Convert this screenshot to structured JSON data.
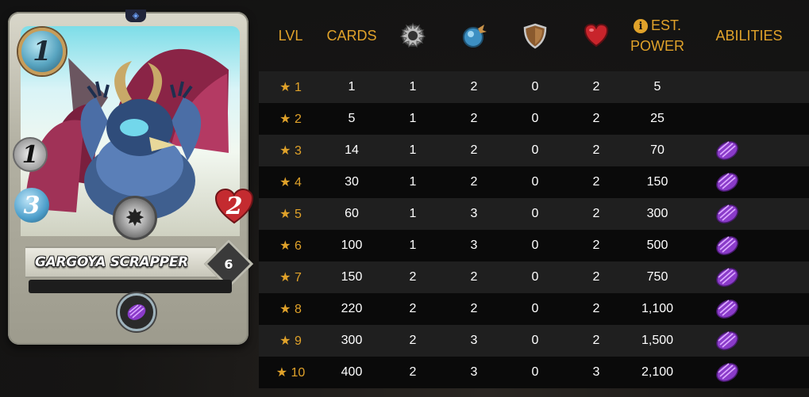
{
  "card": {
    "name": "GARGOYA SCRAPPER",
    "mana": "1",
    "melee": "1",
    "speed": "3",
    "health": "2",
    "level": "6",
    "ability_icon": "scrap-ability-icon",
    "colors": {
      "border": "#bdbcb0",
      "mana": "#58a4c0",
      "health": "#c42b30",
      "ability": "#9a3fd6"
    }
  },
  "table": {
    "headers": {
      "lvl": "LVL",
      "cards": "CARDS",
      "melee_icon": "melee-attack-icon",
      "speed_icon": "speed-icon",
      "armor_icon": "armor-shield-icon",
      "health_icon": "health-heart-icon",
      "est_power_line1": "EST.",
      "est_power_line2": "POWER",
      "abilities": "ABILITIES"
    },
    "rows": [
      {
        "lvl": "1",
        "cards": "1",
        "melee": "1",
        "speed": "2",
        "armor": "0",
        "health": "2",
        "power": "5",
        "ability": false
      },
      {
        "lvl": "2",
        "cards": "5",
        "melee": "1",
        "speed": "2",
        "armor": "0",
        "health": "2",
        "power": "25",
        "ability": false
      },
      {
        "lvl": "3",
        "cards": "14",
        "melee": "1",
        "speed": "2",
        "armor": "0",
        "health": "2",
        "power": "70",
        "ability": true
      },
      {
        "lvl": "4",
        "cards": "30",
        "melee": "1",
        "speed": "2",
        "armor": "0",
        "health": "2",
        "power": "150",
        "ability": true
      },
      {
        "lvl": "5",
        "cards": "60",
        "melee": "1",
        "speed": "3",
        "armor": "0",
        "health": "2",
        "power": "300",
        "ability": true
      },
      {
        "lvl": "6",
        "cards": "100",
        "melee": "1",
        "speed": "3",
        "armor": "0",
        "health": "2",
        "power": "500",
        "ability": true
      },
      {
        "lvl": "7",
        "cards": "150",
        "melee": "2",
        "speed": "2",
        "armor": "0",
        "health": "2",
        "power": "750",
        "ability": true
      },
      {
        "lvl": "8",
        "cards": "220",
        "melee": "2",
        "speed": "2",
        "armor": "0",
        "health": "2",
        "power": "1,100",
        "ability": true
      },
      {
        "lvl": "9",
        "cards": "300",
        "melee": "2",
        "speed": "3",
        "armor": "0",
        "health": "2",
        "power": "1,500",
        "ability": true
      },
      {
        "lvl": "10",
        "cards": "400",
        "melee": "2",
        "speed": "3",
        "armor": "0",
        "health": "3",
        "power": "2,100",
        "ability": true
      }
    ],
    "colors": {
      "header": "#e0a22a",
      "row_odd": "#1f1f1f",
      "row_even": "#0a0a0a"
    }
  }
}
